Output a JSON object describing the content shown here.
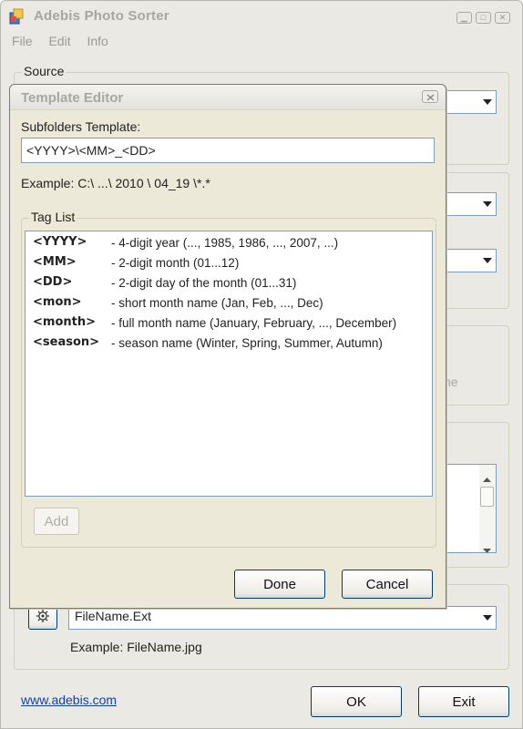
{
  "main_window": {
    "title": "Adebis Photo Sorter",
    "menu": [
      "File",
      "Edit",
      "Info"
    ],
    "source_label": "Source",
    "filename_template": "FileName.Ext",
    "filename_example": "Example: FileName.jpg",
    "partial_text": "ne",
    "website_link": "www.adebis.com",
    "ok_label": "OK",
    "exit_label": "Exit"
  },
  "dialog": {
    "title": "Template Editor",
    "subfolders_label": "Subfolders Template:",
    "subfolders_value": "<YYYY>\\<MM>_<DD>",
    "example_text": "Example: C:\\ ...\\ 2010 \\ 04_19 \\*.*",
    "tag_list_label": "Tag List",
    "tags": [
      {
        "name": "<YYYY>",
        "desc": "- 4-digit year (..., 1985, 1986, ..., 2007, ...)"
      },
      {
        "name": "<MM>",
        "desc": "- 2-digit month (01...12)"
      },
      {
        "name": "<DD>",
        "desc": "- 2-digit day of the month (01...31)"
      },
      {
        "name": "<mon>",
        "desc": "- short month name (Jan, Feb, ..., Dec)"
      },
      {
        "name": "<month>",
        "desc": "- full month name (January, February, ..., December)"
      },
      {
        "name": "<season>",
        "desc": "- season name (Winter, Spring, Summer, Autumn)"
      }
    ],
    "add_label": "Add",
    "done_label": "Done",
    "cancel_label": "Cancel"
  },
  "icons": {
    "app": "app-icon",
    "minimize": "minimize-icon",
    "maximize": "maximize-icon",
    "close": "close-icon",
    "dropdown": "chevron-down-icon",
    "settings": "gear-icon"
  },
  "colors": {
    "window_bg": "#eae9e3",
    "dialog_bg": "#ece9d8",
    "input_border": "#7f9db9",
    "link": "#1340a8",
    "button_border": "#003c74"
  }
}
